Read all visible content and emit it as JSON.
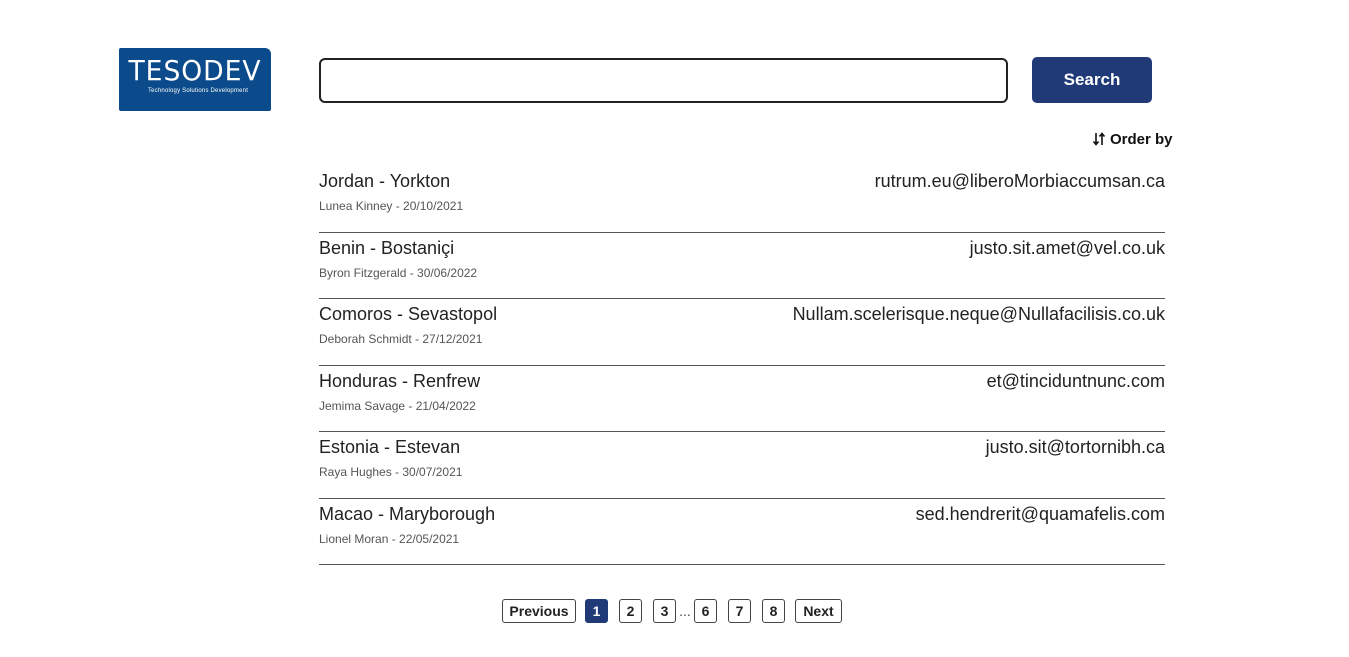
{
  "logo": {
    "word": "TESODEV",
    "tagline": "Technology Solutions Development"
  },
  "search": {
    "value": "",
    "placeholder": "",
    "button_label": "Search"
  },
  "order_by": {
    "label": "Order by",
    "icon": "sort-arrows-icon"
  },
  "results": [
    {
      "title": "Jordan - Yorkton",
      "meta": "Lunea Kinney - 20/10/2021",
      "email": "rutrum.eu@liberoMorbiaccumsan.ca"
    },
    {
      "title": "Benin - Bostaniçi",
      "meta": "Byron Fitzgerald - 30/06/2022",
      "email": "justo.sit.amet@vel.co.uk"
    },
    {
      "title": "Comoros - Sevastopol",
      "meta": "Deborah Schmidt - 27/12/2021",
      "email": "Nullam.scelerisque.neque@Nullafacilisis.co.uk"
    },
    {
      "title": "Honduras - Renfrew",
      "meta": "Jemima Savage - 21/04/2022",
      "email": "et@tinciduntnunc.com"
    },
    {
      "title": "Estonia - Estevan",
      "meta": "Raya Hughes - 30/07/2021",
      "email": "justo.sit@tortornibh.ca"
    },
    {
      "title": "Macao - Maryborough",
      "meta": "Lionel Moran - 22/05/2021",
      "email": "sed.hendrerit@quamafelis.com"
    }
  ],
  "pagination": {
    "previous_label": "Previous",
    "next_label": "Next",
    "pages": [
      "1",
      "2",
      "3",
      "6",
      "7",
      "8"
    ],
    "ellipsis": "...",
    "current": "1"
  },
  "colors": {
    "accent": "#203a78",
    "logo_bg": "#0b4a8b",
    "divider": "#555555"
  }
}
